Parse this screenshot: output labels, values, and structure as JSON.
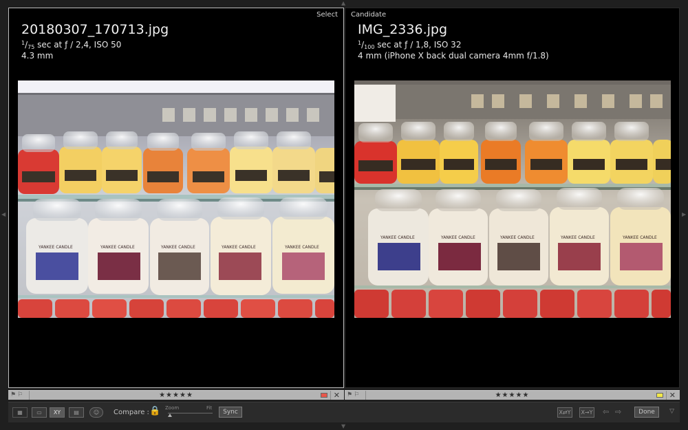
{
  "edge_arrows": {
    "top": "▲",
    "bottom": "▼",
    "left": "◀",
    "right": "▶"
  },
  "left_pane": {
    "label": "Select",
    "filename": "20180307_170713.jpg",
    "shutter_num": "1",
    "shutter_den": "75",
    "exposure_rest": " sec at ƒ / 2,4, ISO 50",
    "focal": "4.3 mm",
    "rating": "★★★★★",
    "color_label": "#e8564a",
    "close": "✕"
  },
  "right_pane": {
    "label": "Candidate",
    "filename": "IMG_2336.jpg",
    "shutter_num": "1",
    "shutter_den": "100",
    "exposure_rest": " sec at ƒ / 1,8, ISO 32",
    "focal": "4 mm (iPhone X back dual camera 4mm f/1.8)",
    "rating": "★★★★★",
    "color_label": "#f2e84a",
    "close": "✕"
  },
  "flags": "⚑⚐",
  "photo_content": {
    "jar_label_text": "YANKEE CANDLE"
  },
  "toolbar": {
    "grid_icon": "▦",
    "loupe_icon": "▭",
    "compare_icon": "XY",
    "survey_icon": "▤",
    "people_icon": "☺",
    "compare_label": "Compare :",
    "lock_icon": "🔒",
    "zoom_label": "Zoom",
    "fit_label": "Fit",
    "zoom_level": 0.05,
    "sync_label": "Sync",
    "swap_icon": "X⇄Y",
    "make_select_icon": "X→Y",
    "prev_icon": "⇦",
    "next_icon": "⇨",
    "done_label": "Done",
    "menu_icon": "▽"
  }
}
